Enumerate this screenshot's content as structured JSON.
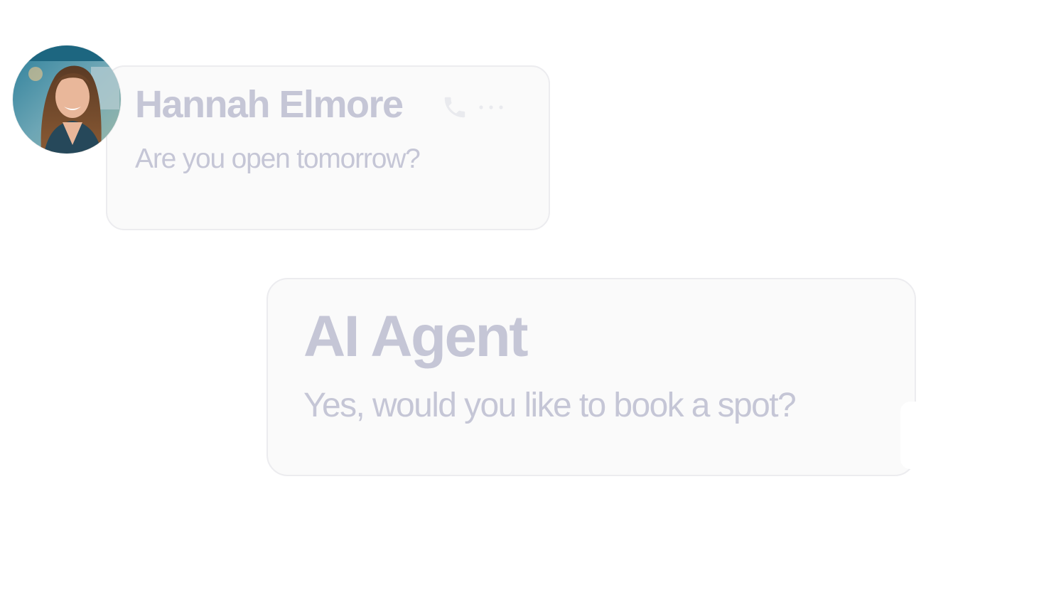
{
  "conversation": {
    "incoming": {
      "sender_name": "Hannah Elmore",
      "message": "Are you open tomorrow?",
      "avatar_icon": "person-photo-avatar",
      "actions": [
        {
          "icon": "phone-icon"
        },
        {
          "icon": "more-options-icon"
        }
      ]
    },
    "outgoing": {
      "sender_name": "AI Agent",
      "message": "Yes, would you like to book a spot?"
    }
  },
  "colors": {
    "background": "#ffffff",
    "bubble_fill": "#fafafa",
    "bubble_border": "#ececef",
    "text": "#c5c6d6"
  }
}
